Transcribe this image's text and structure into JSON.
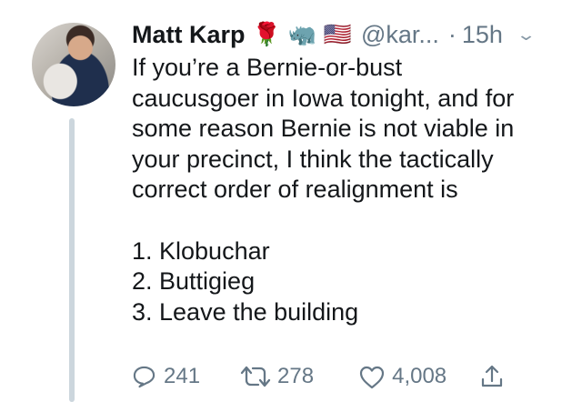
{
  "tweet": {
    "author_name": "Matt Karp",
    "emojis": [
      "🌹",
      "🦏",
      "🇺🇸"
    ],
    "handle": "@kar...",
    "separator": "·",
    "time": "15h",
    "text": "If you’re a Bernie-or-bust\ncaucusgoer in Iowa tonight, and for\nsome reason Bernie is not viable in\nyour precinct, I think the tactically\ncorrect order of realignment is\n\n1. Klobuchar\n2. Buttigieg\n3. Leave the building"
  },
  "actions": {
    "reply_count": "241",
    "retweet_count": "278",
    "like_count": "4,008"
  },
  "colors": {
    "primary_text": "#14171a",
    "secondary_text": "#657786",
    "thread_line": "#ccd6dd"
  },
  "icons": {
    "avatar": "avatar-photo",
    "menu": "chevron-down-icon",
    "reply": "reply-icon",
    "retweet": "retweet-icon",
    "like": "heart-icon",
    "share": "share-icon"
  }
}
